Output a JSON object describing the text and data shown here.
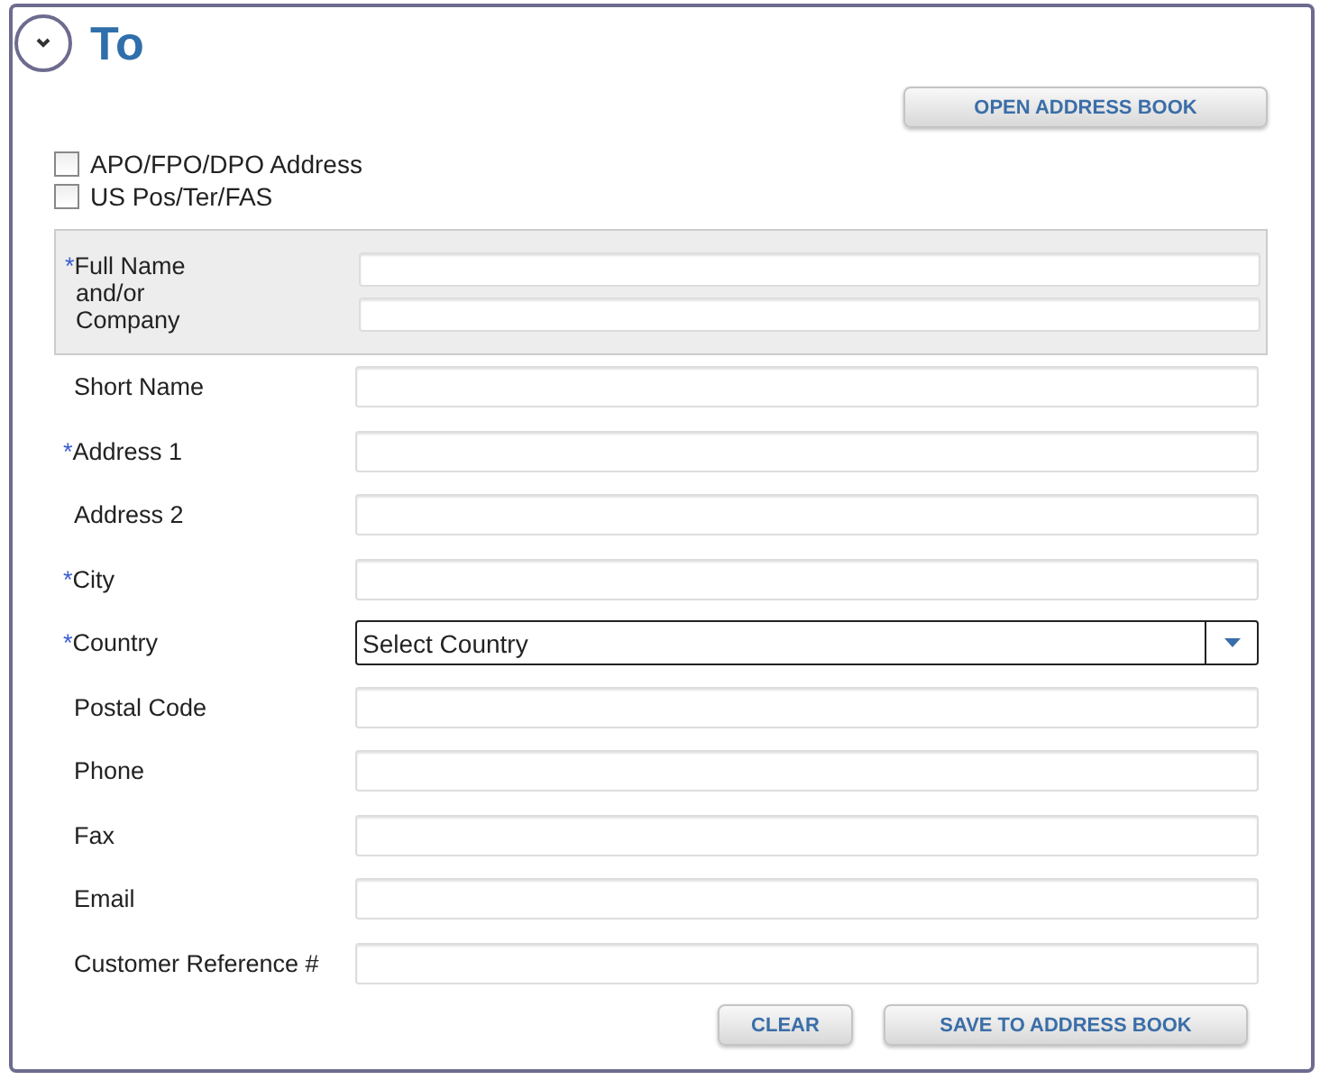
{
  "section": {
    "title": "To",
    "expanded": true
  },
  "open_button": "OPEN ADDRESS BOOK",
  "options": [
    {
      "label": "APO/FPO/DPO Address",
      "checked": false
    },
    {
      "label": "US Pos/Ter/FAS",
      "checked": false
    }
  ],
  "required_mark": "*",
  "fields": [
    {
      "kind": "double",
      "label": "Full Name and/or Company",
      "required": true
    },
    {
      "kind": "text",
      "label": "Short Name",
      "required": false
    },
    {
      "kind": "text",
      "label": "Address 1",
      "required": true
    },
    {
      "kind": "text",
      "label": "Address 2",
      "required": false
    },
    {
      "kind": "text",
      "label": "City",
      "required": true
    },
    {
      "kind": "select",
      "label": "Country",
      "required": true,
      "value": "Select Country"
    },
    {
      "kind": "text",
      "label": "Postal Code",
      "required": false
    },
    {
      "kind": "text",
      "label": "Phone",
      "required": false
    },
    {
      "kind": "text",
      "label": "Fax",
      "required": false
    },
    {
      "kind": "text",
      "label": "Email",
      "required": false
    },
    {
      "kind": "text",
      "label": "Customer Reference #",
      "required": false
    }
  ],
  "buttons": [
    "CLEAR",
    "SAVE TO ADDRESS BOOK"
  ]
}
